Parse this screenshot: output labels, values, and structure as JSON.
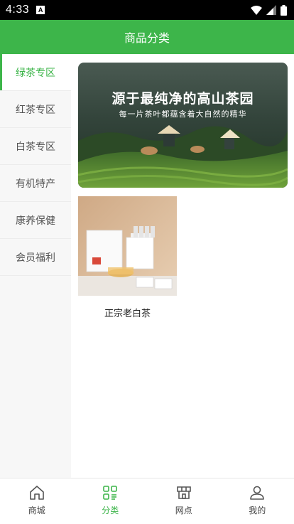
{
  "status_bar": {
    "time": "4:33",
    "notif_glyph": "A"
  },
  "header": {
    "title": "商品分类"
  },
  "sidebar": {
    "items": [
      {
        "label": "绿茶专区",
        "active": true
      },
      {
        "label": "红茶专区",
        "active": false
      },
      {
        "label": "白茶专区",
        "active": false
      },
      {
        "label": "有机特产",
        "active": false
      },
      {
        "label": "康养保健",
        "active": false
      },
      {
        "label": "会员福利",
        "active": false
      }
    ]
  },
  "banner": {
    "title": "源于最纯净的高山茶园",
    "subtitle": "每一片茶叶都蕴含着大自然的精华"
  },
  "products": [
    {
      "name": "正宗老白茶"
    }
  ],
  "bottom_nav": {
    "items": [
      {
        "label": "商城",
        "icon": "home-icon",
        "active": false
      },
      {
        "label": "分类",
        "icon": "category-icon",
        "active": true
      },
      {
        "label": "网点",
        "icon": "store-icon",
        "active": false
      },
      {
        "label": "我的",
        "icon": "user-icon",
        "active": false
      }
    ]
  },
  "colors": {
    "accent": "#3db54a",
    "status_bar": "#000000"
  }
}
